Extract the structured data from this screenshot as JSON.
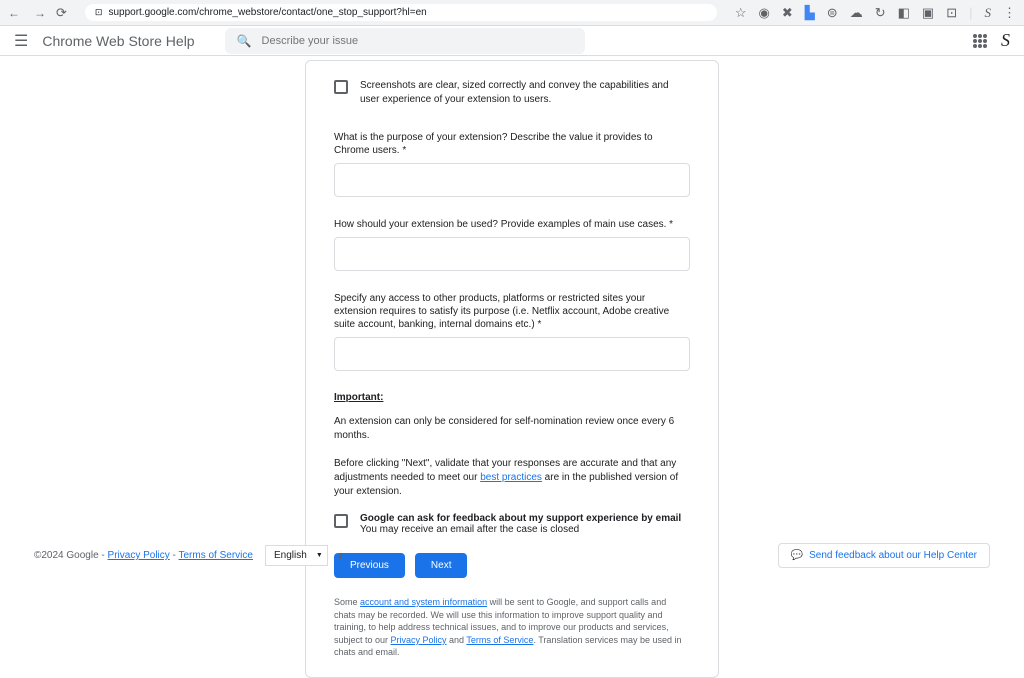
{
  "browser": {
    "url": "support.google.com/chrome_webstore/contact/one_stop_support?hl=en"
  },
  "header": {
    "title": "Chrome Web Store Help",
    "searchPlaceholder": "Describe your issue"
  },
  "form": {
    "check_screenshots": "Screenshots are clear, sized correctly and convey the capabilities and user experience of your extension to users.",
    "q_purpose": "What is the purpose of your extension? Describe the value it provides to Chrome users. *",
    "q_usage": "How should your extension be used? Provide examples of main use cases. *",
    "q_access": "Specify any access to other products, platforms or restricted sites your extension requires to satisfy its purpose (i.e. Netflix account, Adobe creative suite account, banking, internal domains etc.) *",
    "important_label": "Important:",
    "important_p1": "An extension can only be considered for self-nomination review once every 6 months.",
    "important_p2_a": "Before clicking \"Next\", validate that your responses are accurate and that any adjustments needed to meet our ",
    "important_p2_link": "best practices",
    "important_p2_b": " are in the published version of your extension.",
    "feedback_title": "Google can ask for feedback about my support experience by email",
    "feedback_sub": "You may receive an email after the case is closed",
    "prev_btn": "Previous",
    "next_btn": "Next",
    "footnote_a": "Some ",
    "footnote_link1": "account and system information",
    "footnote_b": " will be sent to Google, and support calls and chats may be recorded. We will use this information to improve support quality and training, to help address technical issues, and to improve our products and services, subject to our ",
    "footnote_link2": "Privacy Policy",
    "footnote_and": " and ",
    "footnote_link3": "Terms of Service",
    "footnote_c": ". Translation services may be used in chats and email."
  },
  "footer": {
    "copyright": "©2024 Google - ",
    "privacy": "Privacy Policy",
    "sep": " - ",
    "terms": "Terms of Service",
    "language": "English",
    "feedback_btn": "Send feedback about our Help Center"
  }
}
